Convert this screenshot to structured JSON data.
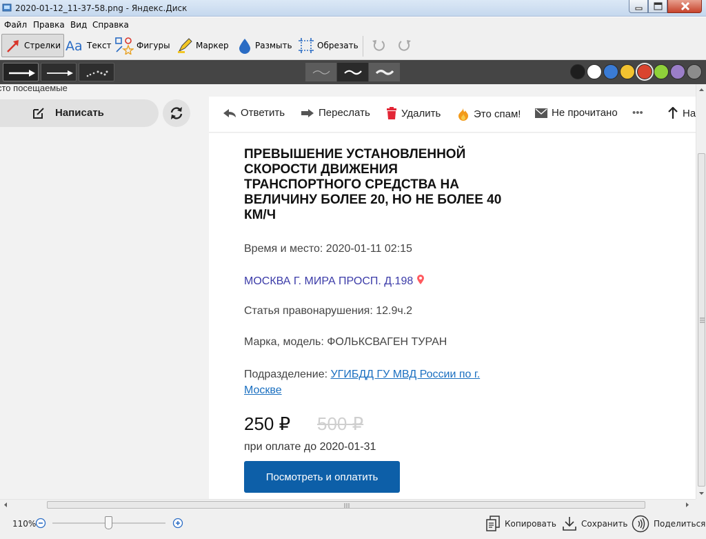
{
  "window": {
    "title": "2020-01-12_11-37-58.png - Яндекс.Диск"
  },
  "menu": [
    "Файл",
    "Правка",
    "Вид",
    "Справка"
  ],
  "tools": {
    "arrows": "Стрелки",
    "text": "Текст",
    "shapes": "Фигуры",
    "marker": "Маркер",
    "blur": "Размыть",
    "crop": "Обрезать",
    "active": "arrows"
  },
  "palette": {
    "colors": [
      "#1e1e1e",
      "#ffffff",
      "#3a7bd5",
      "#f2c230",
      "#d9442e",
      "#8fd13a",
      "#9b7ec8",
      "#8c8c8c"
    ],
    "selected": "#d9442e"
  },
  "mail": {
    "folder_hint": "сто посещаемые",
    "compose_label": "Написать",
    "toolbar": {
      "reply": "Ответить",
      "forward": "Переслать",
      "delete": "Удалить",
      "spam": "Это спам!",
      "unread": "Не прочитано",
      "more": "•••",
      "up_partial": "На"
    },
    "heading": "ПРЕВЫШЕНИЕ УСТАНОВЛЕННОЙ СКОРОСТИ ДВИЖЕНИЯ ТРАНСПОРТНОГО СРЕДСТВА НА ВЕЛИЧИНУ БОЛЕЕ 20, НО НЕ БОЛЕЕ 40 КМ/Ч",
    "time_place": "Время и место: 2020-01-11 02:15",
    "address": "МОСКВА Г. МИРА ПРОСП. Д.198",
    "article": "Статья правонарушения: 12.9ч.2",
    "car": "Марка, модель: ФОЛЬКСВАГЕН ТУРАН",
    "department_label": "Подразделение: ",
    "department_link_1": "УГИБДД ГУ МВД России по г.",
    "department_link_2": "Москве",
    "price_now": "250 ₽",
    "price_old": "500 ₽",
    "pay_until": "при оплате до 2020-01-31",
    "pay_button": "Посмотреть и оплатить"
  },
  "status": {
    "zoom": "110%",
    "copy": "Копировать",
    "save": "Сохранить",
    "share": "Поделиться"
  }
}
